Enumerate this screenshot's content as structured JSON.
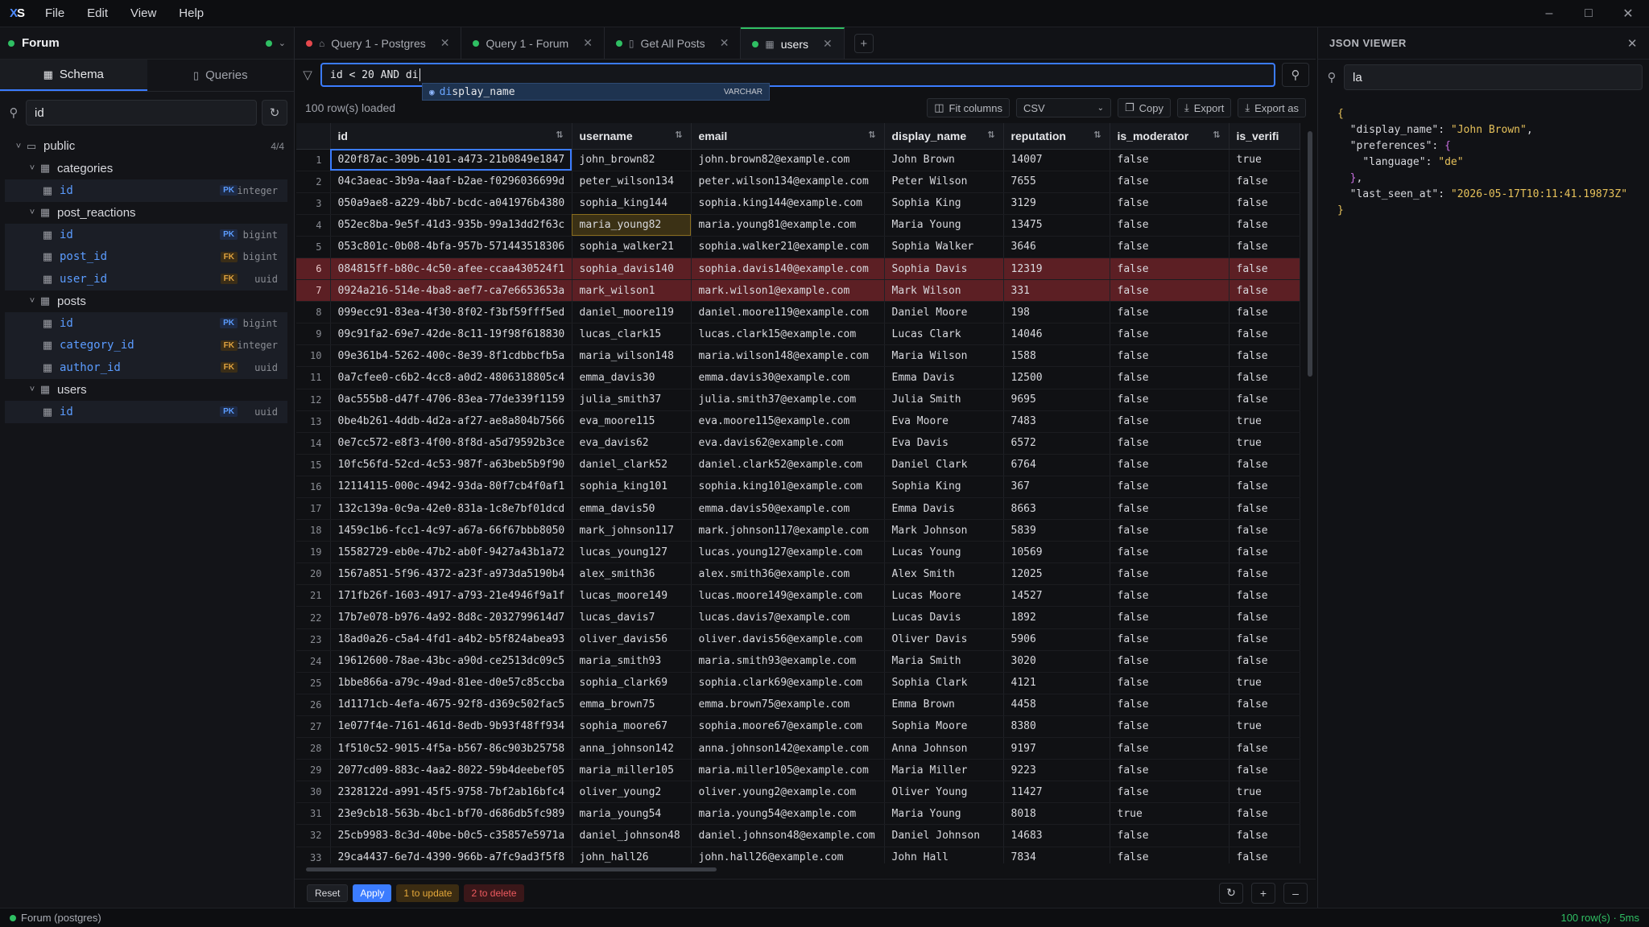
{
  "app": {
    "logo_text": "XS",
    "menu": [
      "File",
      "Edit",
      "View",
      "Help"
    ],
    "window_controls": [
      "minimize",
      "maximize",
      "close"
    ]
  },
  "sidebar": {
    "connection_name": "Forum",
    "tabs": [
      {
        "label": "Schema",
        "active": true
      },
      {
        "label": "Queries",
        "active": false
      }
    ],
    "search_value": "id",
    "tree": [
      {
        "kind": "schema",
        "name": "public",
        "badge": "4/4",
        "depth": 0
      },
      {
        "kind": "table",
        "name": "categories",
        "depth": 1
      },
      {
        "kind": "column",
        "name": "id",
        "key": "PK",
        "type": "integer"
      },
      {
        "kind": "table",
        "name": "post_reactions",
        "depth": 1
      },
      {
        "kind": "column",
        "name": "id",
        "key": "PK",
        "type": "bigint"
      },
      {
        "kind": "column",
        "name": "post_id",
        "key": "FK",
        "type": "bigint"
      },
      {
        "kind": "column",
        "name": "user_id",
        "key": "FK",
        "type": "uuid"
      },
      {
        "kind": "table",
        "name": "posts",
        "depth": 1
      },
      {
        "kind": "column",
        "name": "id",
        "key": "PK",
        "type": "bigint"
      },
      {
        "kind": "column",
        "name": "category_id",
        "key": "FK",
        "type": "integer"
      },
      {
        "kind": "column",
        "name": "author_id",
        "key": "FK",
        "type": "uuid"
      },
      {
        "kind": "table",
        "name": "users",
        "depth": 1
      },
      {
        "kind": "column",
        "name": "id",
        "key": "PK",
        "type": "uuid"
      }
    ]
  },
  "tabs": [
    {
      "label": "Query 1 - Postgres",
      "status": "red",
      "icon": "lock",
      "active": false
    },
    {
      "label": "Query 1 - Forum",
      "status": "green",
      "icon": "",
      "active": false
    },
    {
      "label": "Get All Posts",
      "status": "green",
      "icon": "bookmark",
      "active": false
    },
    {
      "label": "users",
      "status": "green",
      "icon": "table",
      "active": true
    }
  ],
  "filter": {
    "value": "id < 20 AND di",
    "autocomplete": {
      "match": "di",
      "rest": "splay_name",
      "type": "VARCHAR"
    }
  },
  "toolbar": {
    "rows_loaded": "100 row(s) loaded",
    "fit_columns": "Fit columns",
    "format": "CSV",
    "copy": "Copy",
    "export": "Export",
    "export_as": "Export as"
  },
  "grid": {
    "columns": [
      {
        "name": "id",
        "width": 300
      },
      {
        "name": "username",
        "width": 148
      },
      {
        "name": "email",
        "width": 240
      },
      {
        "name": "display_name",
        "width": 148
      },
      {
        "name": "reputation",
        "width": 132
      },
      {
        "name": "is_moderator",
        "width": 148
      },
      {
        "name": "is_verifi",
        "width": 88
      }
    ],
    "selected_cell": [
      0,
      0
    ],
    "edited_cell": [
      3,
      1
    ],
    "deleted_rows": [
      5,
      6
    ],
    "rows": [
      [
        "020f87ac-309b-4101-a473-21b0849e1847",
        "john_brown82",
        "john.brown82@example.com",
        "John Brown",
        "14007",
        "false",
        "true"
      ],
      [
        "04c3aeac-3b9a-4aaf-b2ae-f0296036699d",
        "peter_wilson134",
        "peter.wilson134@example.com",
        "Peter Wilson",
        "7655",
        "false",
        "false"
      ],
      [
        "050a9ae8-a229-4bb7-bcdc-a041976b4380",
        "sophia_king144",
        "sophia.king144@example.com",
        "Sophia King",
        "3129",
        "false",
        "false"
      ],
      [
        "052ec8ba-9e5f-41d3-935b-99a13dd2f63c",
        "maria_young82",
        "maria.young81@example.com",
        "Maria Young",
        "13475",
        "false",
        "false"
      ],
      [
        "053c801c-0b08-4bfa-957b-571443518306",
        "sophia_walker21",
        "sophia.walker21@example.com",
        "Sophia Walker",
        "3646",
        "false",
        "false"
      ],
      [
        "084815ff-b80c-4c50-afee-ccaa430524f1",
        "sophia_davis140",
        "sophia.davis140@example.com",
        "Sophia Davis",
        "12319",
        "false",
        "false"
      ],
      [
        "0924a216-514e-4ba8-aef7-ca7e6653653a",
        "mark_wilson1",
        "mark.wilson1@example.com",
        "Mark Wilson",
        "331",
        "false",
        "false"
      ],
      [
        "099ecc91-83ea-4f30-8f02-f3bf59fff5ed",
        "daniel_moore119",
        "daniel.moore119@example.com",
        "Daniel Moore",
        "198",
        "false",
        "false"
      ],
      [
        "09c91fa2-69e7-42de-8c11-19f98f618830",
        "lucas_clark15",
        "lucas.clark15@example.com",
        "Lucas Clark",
        "14046",
        "false",
        "false"
      ],
      [
        "09e361b4-5262-400c-8e39-8f1cdbbcfb5a",
        "maria_wilson148",
        "maria.wilson148@example.com",
        "Maria Wilson",
        "1588",
        "false",
        "false"
      ],
      [
        "0a7cfee0-c6b2-4cc8-a0d2-4806318805c4",
        "emma_davis30",
        "emma.davis30@example.com",
        "Emma Davis",
        "12500",
        "false",
        "false"
      ],
      [
        "0ac555b8-d47f-4706-83ea-77de339f1159",
        "julia_smith37",
        "julia.smith37@example.com",
        "Julia Smith",
        "9695",
        "false",
        "false"
      ],
      [
        "0be4b261-4ddb-4d2a-af27-ae8a804b7566",
        "eva_moore115",
        "eva.moore115@example.com",
        "Eva Moore",
        "7483",
        "false",
        "true"
      ],
      [
        "0e7cc572-e8f3-4f00-8f8d-a5d79592b3ce",
        "eva_davis62",
        "eva.davis62@example.com",
        "Eva Davis",
        "6572",
        "false",
        "true"
      ],
      [
        "10fc56fd-52cd-4c53-987f-a63beb5b9f90",
        "daniel_clark52",
        "daniel.clark52@example.com",
        "Daniel Clark",
        "6764",
        "false",
        "false"
      ],
      [
        "12114115-000c-4942-93da-80f7cb4f0af1",
        "sophia_king101",
        "sophia.king101@example.com",
        "Sophia King",
        "367",
        "false",
        "false"
      ],
      [
        "132c139a-0c9a-42e0-831a-1c8e7bf01dcd",
        "emma_davis50",
        "emma.davis50@example.com",
        "Emma Davis",
        "8663",
        "false",
        "false"
      ],
      [
        "1459c1b6-fcc1-4c97-a67a-66f67bbb8050",
        "mark_johnson117",
        "mark.johnson117@example.com",
        "Mark Johnson",
        "5839",
        "false",
        "false"
      ],
      [
        "15582729-eb0e-47b2-ab0f-9427a43b1a72",
        "lucas_young127",
        "lucas.young127@example.com",
        "Lucas Young",
        "10569",
        "false",
        "false"
      ],
      [
        "1567a851-5f96-4372-a23f-a973da5190b4",
        "alex_smith36",
        "alex.smith36@example.com",
        "Alex Smith",
        "12025",
        "false",
        "false"
      ],
      [
        "171fb26f-1603-4917-a793-21e4946f9a1f",
        "lucas_moore149",
        "lucas.moore149@example.com",
        "Lucas Moore",
        "14527",
        "false",
        "false"
      ],
      [
        "17b7e078-b976-4a92-8d8c-2032799614d7",
        "lucas_davis7",
        "lucas.davis7@example.com",
        "Lucas Davis",
        "1892",
        "false",
        "false"
      ],
      [
        "18ad0a26-c5a4-4fd1-a4b2-b5f824abea93",
        "oliver_davis56",
        "oliver.davis56@example.com",
        "Oliver Davis",
        "5906",
        "false",
        "false"
      ],
      [
        "19612600-78ae-43bc-a90d-ce2513dc09c5",
        "maria_smith93",
        "maria.smith93@example.com",
        "Maria Smith",
        "3020",
        "false",
        "false"
      ],
      [
        "1bbe866a-a79c-49ad-81ee-d0e57c85ccba",
        "sophia_clark69",
        "sophia.clark69@example.com",
        "Sophia Clark",
        "4121",
        "false",
        "true"
      ],
      [
        "1d1171cb-4efa-4675-92f8-d369c502fac5",
        "emma_brown75",
        "emma.brown75@example.com",
        "Emma Brown",
        "4458",
        "false",
        "false"
      ],
      [
        "1e077f4e-7161-461d-8edb-9b93f48ff934",
        "sophia_moore67",
        "sophia.moore67@example.com",
        "Sophia Moore",
        "8380",
        "false",
        "true"
      ],
      [
        "1f510c52-9015-4f5a-b567-86c903b25758",
        "anna_johnson142",
        "anna.johnson142@example.com",
        "Anna Johnson",
        "9197",
        "false",
        "false"
      ],
      [
        "2077cd09-883c-4aa2-8022-59b4deebef05",
        "maria_miller105",
        "maria.miller105@example.com",
        "Maria Miller",
        "9223",
        "false",
        "false"
      ],
      [
        "2328122d-a991-45f5-9758-7bf2ab16bfc4",
        "oliver_young2",
        "oliver.young2@example.com",
        "Oliver Young",
        "11427",
        "false",
        "true"
      ],
      [
        "23e9cb18-563b-4bc1-bf70-d686db5fc989",
        "maria_young54",
        "maria.young54@example.com",
        "Maria Young",
        "8018",
        "true",
        "false"
      ],
      [
        "25cb9983-8c3d-40be-b0c5-c35857e5971a",
        "daniel_johnson48",
        "daniel.johnson48@example.com",
        "Daniel Johnson",
        "14683",
        "false",
        "false"
      ],
      [
        "29ca4437-6e7d-4390-966b-a7fc9ad3f5f8",
        "john_hall26",
        "john.hall26@example.com",
        "John Hall",
        "7834",
        "false",
        "false"
      ]
    ]
  },
  "actions": {
    "reset": "Reset",
    "apply": "Apply",
    "to_update": "1 to update",
    "to_delete": "2 to delete"
  },
  "json_viewer": {
    "title": "JSON VIEWER",
    "search_value": "la",
    "lines": [
      [
        {
          "t": "{",
          "c": "jb"
        }
      ],
      [
        {
          "t": "  ",
          "c": ""
        },
        {
          "t": "\"display_name\"",
          "c": "jk"
        },
        {
          "t": ": ",
          "c": ""
        },
        {
          "t": "\"John Brown\"",
          "c": "js"
        },
        {
          "t": ",",
          "c": ""
        }
      ],
      [
        {
          "t": "  ",
          "c": ""
        },
        {
          "t": "\"preferences\"",
          "c": "jk"
        },
        {
          "t": ": ",
          "c": ""
        },
        {
          "t": "{",
          "c": "jbr2"
        }
      ],
      [
        {
          "t": "    ",
          "c": ""
        },
        {
          "t": "\"language\"",
          "c": "jk"
        },
        {
          "t": ": ",
          "c": ""
        },
        {
          "t": "\"de\"",
          "c": "js"
        }
      ],
      [
        {
          "t": "  ",
          "c": ""
        },
        {
          "t": "}",
          "c": "jbr2"
        },
        {
          "t": ",",
          "c": ""
        }
      ],
      [
        {
          "t": "  ",
          "c": ""
        },
        {
          "t": "\"last_seen_at\"",
          "c": "jk"
        },
        {
          "t": ": ",
          "c": ""
        },
        {
          "t": "\"2026-05-17T10:11:41.19873Z\"",
          "c": "js"
        }
      ],
      [
        {
          "t": "}",
          "c": "jb"
        }
      ]
    ]
  },
  "status": {
    "connection": "Forum (postgres)",
    "summary": "100 row(s) · 5ms"
  },
  "colors": {
    "accent": "#3b7cff",
    "connected": "#2fbf63",
    "error": "#e5484d",
    "delete_row": "#5c1f24"
  }
}
